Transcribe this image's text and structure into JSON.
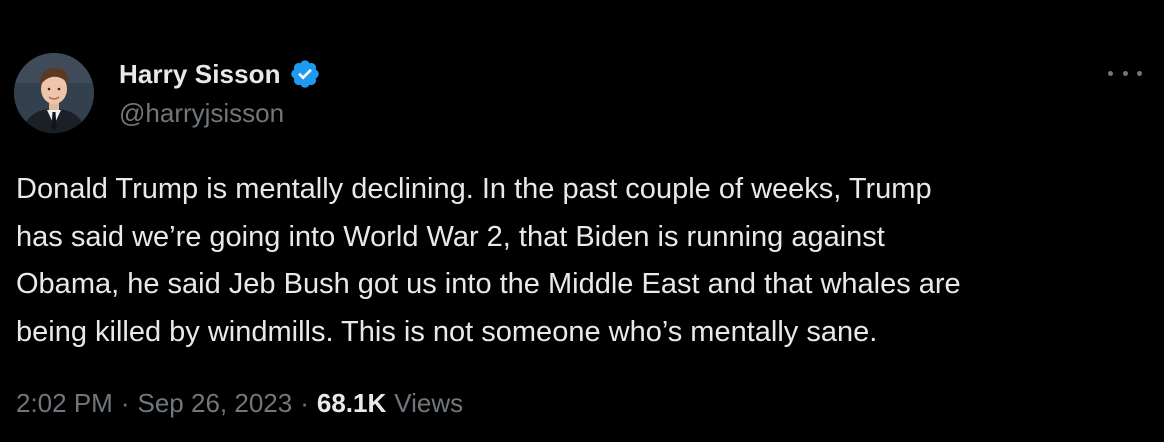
{
  "author": {
    "display_name": "Harry Sisson",
    "handle": "@harryjsisson",
    "verified": true
  },
  "tweet": {
    "text": "Donald Trump is mentally declining. In the past couple of weeks, Trump\nhas said we’re going into World War 2, that Biden is running against\nObama, he said Jeb Bush got us into the Middle East and that whales are\nbeing killed by windmills. This is not someone who’s mentally sane.",
    "time": "2:02 PM",
    "date": "Sep 26, 2023",
    "separator": "·",
    "views_count": "68.1K",
    "views_label": "Views"
  },
  "icons": {
    "verified": "verified-badge-icon",
    "more": "more-options-icon"
  },
  "colors": {
    "background": "#000000",
    "primary_text": "#e7e9ea",
    "secondary_text": "#71767b",
    "verified_blue": "#1d9bf0"
  }
}
